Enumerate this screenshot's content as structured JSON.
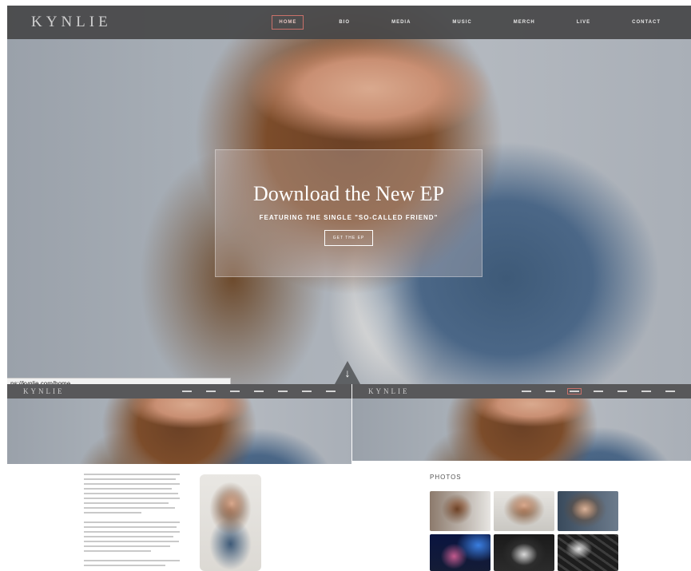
{
  "site": {
    "logo": "KYNLIE"
  },
  "nav": {
    "items": [
      {
        "label": "HOME",
        "active": true
      },
      {
        "label": "BIO",
        "active": false
      },
      {
        "label": "MEDIA",
        "active": false
      },
      {
        "label": "MUSIC",
        "active": false
      },
      {
        "label": "MERCH",
        "active": false
      },
      {
        "label": "LIVE",
        "active": false
      },
      {
        "label": "CONTACT",
        "active": false
      }
    ]
  },
  "hero": {
    "title": "Download the New EP",
    "subtitle": "FEATURING THE SINGLE \"SO-CALLED FRIEND\"",
    "button": "GET THE EP",
    "scroll_icon": "arrow-down-icon"
  },
  "status_bar": {
    "url": "ps://kynlie.com/home"
  },
  "bio_page": {
    "logo": "KYNLIE"
  },
  "photos_page": {
    "logo": "KYNLIE",
    "section_title": "PHOTOS"
  },
  "colors": {
    "nav_bg": "#464648",
    "accent_active": "#c9716a",
    "hero_overlay": "#dccdcd"
  }
}
